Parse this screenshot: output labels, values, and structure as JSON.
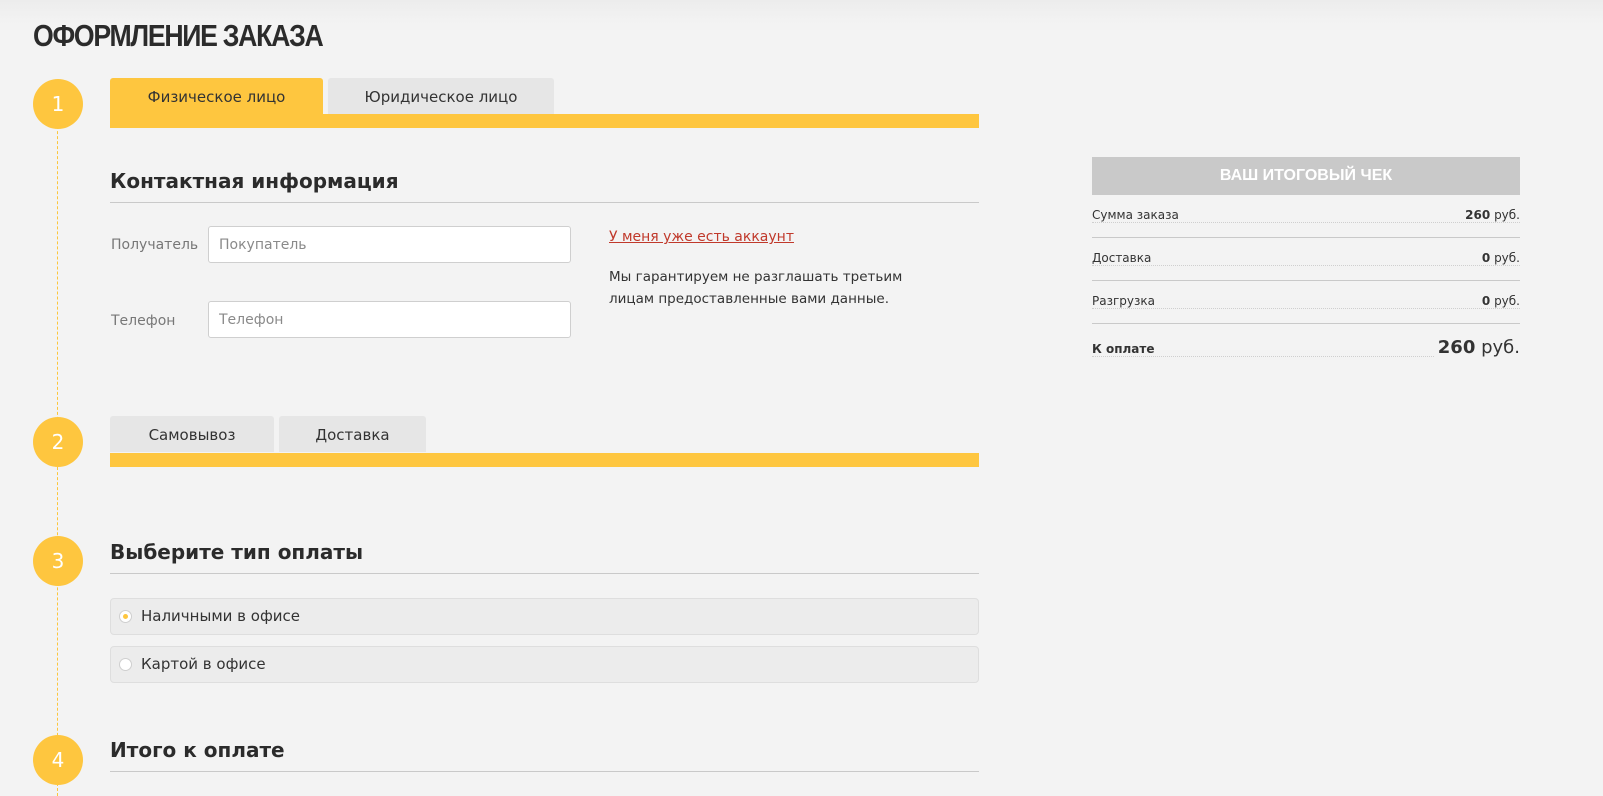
{
  "page": {
    "title": "ОФОРМЛЕНИЕ ЗАКАЗА"
  },
  "steps": [
    "1",
    "2",
    "3",
    "4"
  ],
  "customer_tabs": [
    {
      "label": "Физическое лицо",
      "active": true
    },
    {
      "label": "Юридическое лицо",
      "active": false
    }
  ],
  "contact": {
    "title": "Контактная информация",
    "recipient_label": "Получатель",
    "recipient_placeholder": "Покупатель",
    "phone_label": "Телефон",
    "phone_placeholder": "Телефон",
    "account_link": "У меня уже есть аккаунт",
    "privacy_note": "Мы гарантируем не разглашать третьим лицам предоставленные вами данные."
  },
  "delivery_tabs": [
    {
      "label": "Самовывоз"
    },
    {
      "label": "Доставка"
    }
  ],
  "payment": {
    "title": "Выберите тип оплаты",
    "options": [
      {
        "label": "Наличными в офисе",
        "selected": true
      },
      {
        "label": "Картой в офисе",
        "selected": false
      }
    ]
  },
  "total_section": {
    "title": "Итого к оплате"
  },
  "receipt": {
    "title": "ВАШ ИТОГОВЫЙ ЧЕК",
    "currency": "руб.",
    "rows": [
      {
        "label": "Сумма заказа",
        "value": "260"
      },
      {
        "label": "Доставка",
        "value": "0"
      },
      {
        "label": "Разгрузка",
        "value": "0"
      }
    ],
    "total": {
      "label": "К оплате",
      "value": "260"
    }
  },
  "colors": {
    "accent": "#fec63f",
    "link": "#c0392b",
    "background": "#f3f3f3",
    "receipt_header": "#c9c9c9"
  }
}
